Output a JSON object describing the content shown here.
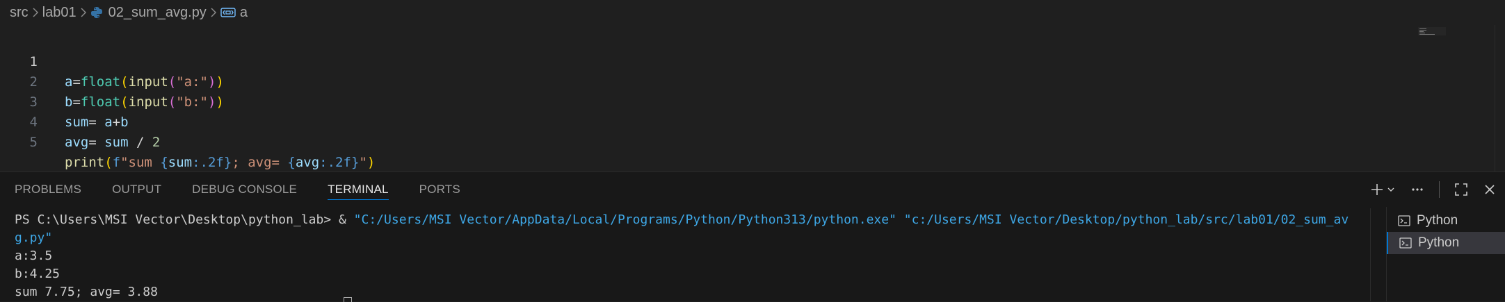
{
  "breadcrumb": {
    "items": [
      "src",
      "lab01",
      "02_sum_avg.py",
      "a"
    ]
  },
  "editor": {
    "lines": [
      {
        "num": "1"
      },
      {
        "num": "2"
      },
      {
        "num": "3"
      },
      {
        "num": "4"
      },
      {
        "num": "5"
      }
    ],
    "code": {
      "l1": {
        "a": "a",
        "eq": "=",
        "float": "float",
        "lp1": "(",
        "input": "input",
        "lp2": "(",
        "str": "\"a:\"",
        "rp2": ")",
        "rp1": ")"
      },
      "l2": {
        "b": "b",
        "eq": "=",
        "float": "float",
        "lp1": "(",
        "input": "input",
        "lp2": "(",
        "str": "\"b:\"",
        "rp2": ")",
        "rp1": ")"
      },
      "l3": {
        "sum": "sum",
        "eq": "= ",
        "a": "a",
        "plus": "+",
        "b": "b"
      },
      "l4": {
        "avg": "avg",
        "eq": "= ",
        "sum": "sum",
        "div": " / ",
        "two": "2"
      },
      "l5": {
        "print": "print",
        "lp": "(",
        "fpre": "f",
        "s1": "\"sum ",
        "b1o": "{",
        "sum": "sum",
        "fmt1": ":.2f",
        "b1c": "}",
        "s2": "; avg= ",
        "b2o": "{",
        "avg": "avg",
        "fmt2": ":.2f",
        "b2c": "}",
        "s3": "\"",
        "rp": ")"
      }
    }
  },
  "panel": {
    "tabs": [
      "PROBLEMS",
      "OUTPUT",
      "DEBUG CONSOLE",
      "TERMINAL",
      "PORTS"
    ],
    "active_tab": "TERMINAL"
  },
  "terminal": {
    "prompt": "PS C:\\Users\\MSI Vector\\Desktop\\python_lab> & ",
    "exe": "\"C:/Users/MSI Vector/AppData/Local/Programs/Python/Python313/python.exe\"",
    "space": " ",
    "script_part1": "\"c:/Users/MSI Vector/Desktop/python_lab/src/lab01/02_sum_av",
    "script_part2": "g.py\"",
    "out1": "a:3.5",
    "out2": "b:4.25",
    "out3": "sum 7.75; avg= 3.88"
  },
  "terminals": [
    "Python",
    "Python"
  ],
  "colors": {
    "accent": "#0078d4",
    "string_blue": "#3ea7e6"
  }
}
